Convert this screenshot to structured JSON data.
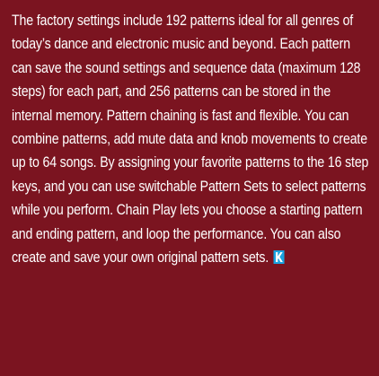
{
  "article": {
    "paragraph": "The factory settings include 192 patterns ideal for all genres of today’s dance and electronic music and beyond. Each pattern can save the sound settings and sequence data (maximum 128 steps) for each part, and 256 patterns can be stored in the internal memory. Pattern chaining is fast and flexible. You can combine patterns, add mute data and knob movements to create up to 64 songs. By assigning your favorite patterns to the 16 step keys, and you can use switchable Pattern Sets to select patterns while you perform. Chain Play lets you choose a starting pattern and ending pattern, and loop the performance. You can also create and save your own original pattern sets.",
    "end_mark_icon": "k-end-mark-icon",
    "background_color": "#7b1420",
    "text_color": "#ffffff",
    "end_mark_color": "#1aa3e0"
  }
}
